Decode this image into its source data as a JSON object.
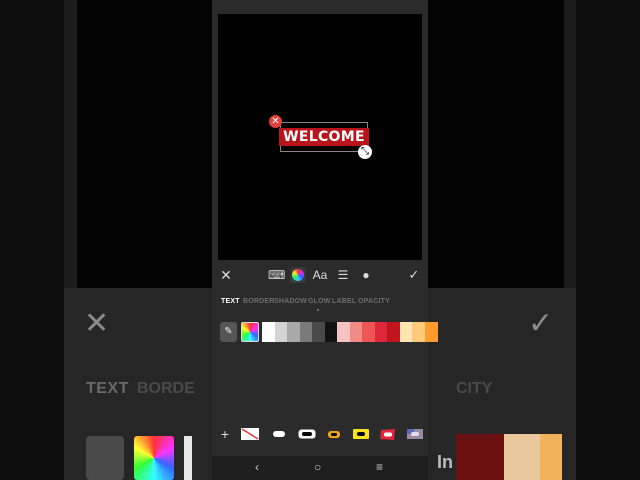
{
  "background": {
    "text_tab": "TEXT",
    "border_tab_partial": "BORDE",
    "opacity_tab_partial": "CITY",
    "close_glyph": "✕",
    "check_glyph": "✓",
    "watermark": "In"
  },
  "canvas": {
    "text": "WELCOME",
    "text_color": "#ffffff",
    "label_color": "#b8141b",
    "delete_glyph": "✕",
    "resize_glyph": "⤡"
  },
  "toolbar": {
    "close": "✕",
    "keyboard": "⌨",
    "font": "Aa",
    "align": "☰",
    "shape": "●",
    "confirm": "✓"
  },
  "tabs": [
    "TEXT",
    "BORDER",
    "SHADOW",
    "GLOW",
    "LABEL",
    "OPACITY"
  ],
  "active_tab": "TEXT",
  "swatch_colors": [
    "#ffffff",
    "#d4d4d4",
    "#a8a8a8",
    "#7a7a7a",
    "#4a4a4a",
    "#111111",
    "#f6c3c3",
    "#f28a8a",
    "#ee5555",
    "#e0263a",
    "#c0141f",
    "#ffe3b0",
    "#ffc97a",
    "#ff9a2e"
  ],
  "picker_glyph": "✎",
  "label_styles": {
    "add": "+"
  },
  "nav": {
    "back": "‹",
    "home": "○",
    "menu": "≡"
  }
}
